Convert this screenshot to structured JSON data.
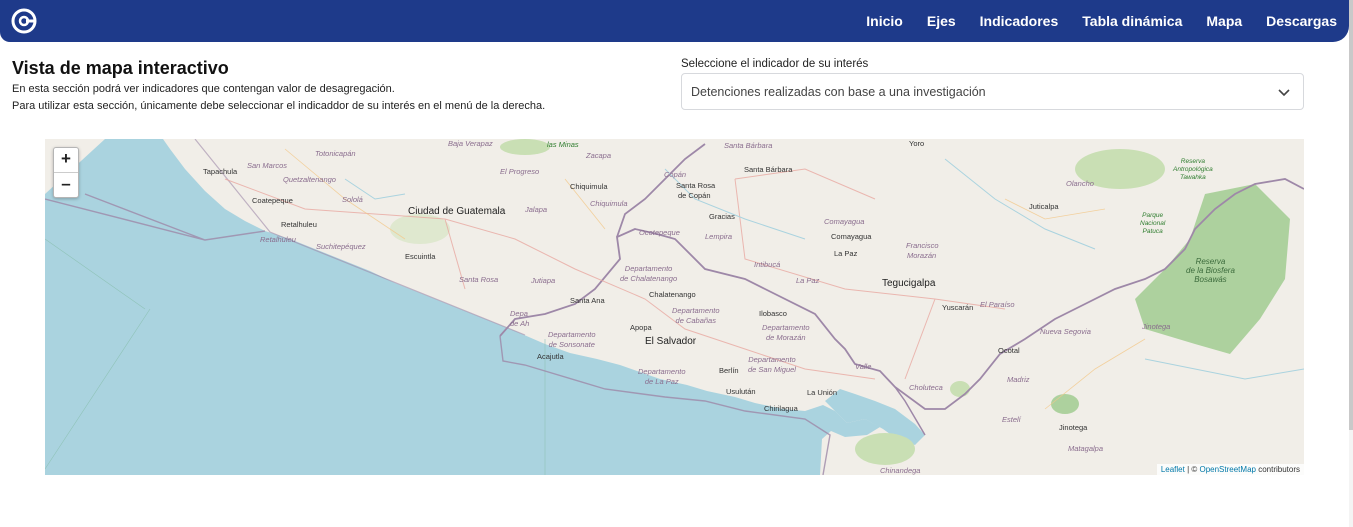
{
  "nav": {
    "logo_icon": "app-logo-icon",
    "items": [
      "Inicio",
      "Ejes",
      "Indicadores",
      "Tabla dinámica",
      "Mapa",
      "Descargas"
    ],
    "background": "#1e3a8a"
  },
  "page": {
    "title": "Vista de mapa interactivo",
    "desc1": "En esta sección podrá ver indicadores que contengan valor de desagregación.",
    "desc2": "Para utilizar esta sección, únicamente debe seleccionar el indicaddor de su interés en el menú de la derecha."
  },
  "selector": {
    "label": "Seleccione el indicador de su interés",
    "value": "Detenciones realizadas con base a una investigación",
    "icon": "chevron-down-icon"
  },
  "map": {
    "zoom_in": "+",
    "zoom_out": "–",
    "attribution": {
      "leaflet": "Leaflet",
      "separator": " | © ",
      "osm": "OpenStreetMap",
      "suffix": " contributors"
    },
    "water_color": "#aad3df",
    "land_color": "#f1eee8",
    "border_color": "#9e88a8",
    "labels": {
      "tapachula": "Tapachula",
      "coatepeque": "Coatepeque",
      "retalhuleu": "Retalhuleu",
      "san_marcos": "San Marcos",
      "quetzaltenango": "Quetzaltenango",
      "solola": "Sololá",
      "retalhuleu_dept": "Retalhuleu",
      "suchitepequez": "Suchitepéquez",
      "escuintla": "Escuintla",
      "totonicapan": "Totonicapán",
      "baja_verapaz": "Baja Verapaz",
      "el_progreso": "El Progreso",
      "las_minas": "las Minas",
      "zacapa": "Zacapa",
      "ciudad_guatemala": "Ciudad de Guatemala",
      "jalapa": "Jalapa",
      "chiquimula": "Chiquimula",
      "chiquimula_dept": "Chiquimula",
      "santa_rosa": "Santa Rosa",
      "jutiapa": "Jutiapa",
      "copan": "Copán",
      "santa_rosa_copan_1": "Santa Rosa",
      "santa_rosa_copan_2": "de Copán",
      "santa_barbara_dept": "Santa Bárbara",
      "santa_barbara": "Santa Bárbara",
      "gracias": "Gracias",
      "ocotepeque": "Ocotepeque",
      "lempira": "Lempira",
      "comayagua_dept": "Comayagua",
      "comayagua": "Comayagua",
      "intibuca": "Intibucá",
      "la_paz_hn": "La Paz",
      "la_paz_dept_hn": "La Paz",
      "francisco_morazan_1": "Francisco",
      "francisco_morazan_2": "Morazán",
      "yoro": "Yoro",
      "olancho": "Olancho",
      "juticalpa": "Juticalpa",
      "tegucigalpa": "Tegucigalpa",
      "yuscaran": "Yuscarán",
      "el_paraiso": "El Paraíso",
      "nueva_segovia": "Nueva Segovia",
      "ocotal": "Ocotal",
      "madriz": "Madriz",
      "esteli": "Estelí",
      "jinotega": "Jinotega",
      "jinotega_dept": "Jinotega",
      "matagalpa": "Matagalpa",
      "chinandega": "Chinandega",
      "valle": "Valle",
      "choluteca": "Choluteca",
      "reserva_tawahka_1": "Reserva",
      "reserva_tawahka_2": "Antropológica",
      "reserva_tawahka_3": "Tawahka",
      "parque_patuca_1": "Parque",
      "parque_patuca_2": "Nacional",
      "parque_patuca_3": "Patuca",
      "bosawas_1": "Reserva",
      "bosawas_2": "de la Biosfera",
      "bosawas_3": "Bosawás",
      "chalatenango_dept_1": "Departamento",
      "chalatenango_dept_2": "de Chalatenango",
      "chalatenango": "Chalatenango",
      "santa_ana": "Santa Ana",
      "cabanas_1": "Departamento",
      "cabanas_2": "de Cabañas",
      "dept_ah_1": "Depa",
      "dept_ah_2": "de Ah",
      "sonsonate_1": "Departamento",
      "sonsonate_2": "de Sonsonate",
      "apopa": "Apopa",
      "el_salvador": "El Salvador",
      "acajutla": "Acajutla",
      "ilobasco": "Ilobasco",
      "morazan_1": "Departamento",
      "morazan_2": "de Morazán",
      "la_paz_sv_1": "Departamento",
      "la_paz_sv_2": "de La Paz",
      "san_miguel_1": "Departamento",
      "san_miguel_2": "de San Miguel",
      "berlin": "Berlín",
      "usulutan": "Usulután",
      "chirilagua": "Chirilagua",
      "la_union": "La Unión"
    }
  }
}
